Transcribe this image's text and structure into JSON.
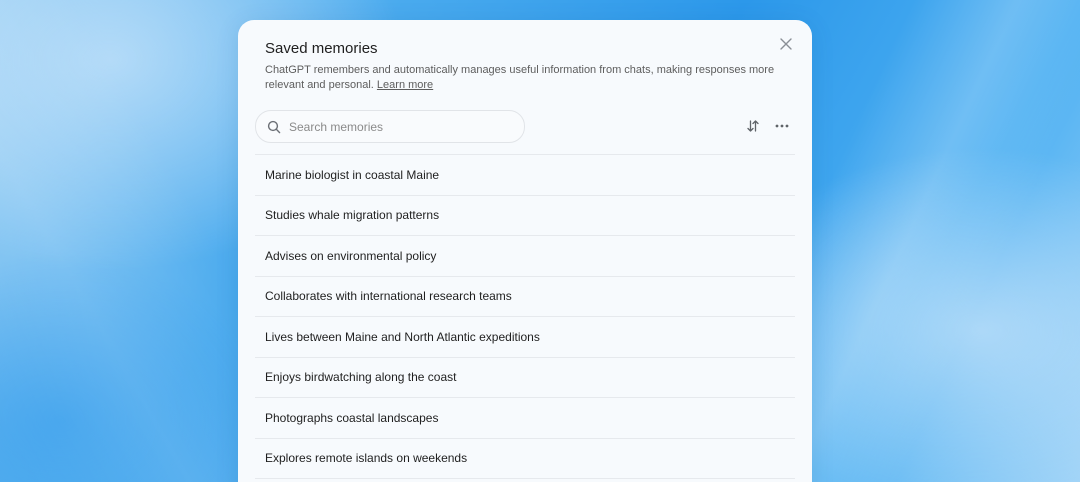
{
  "modal": {
    "title": "Saved memories",
    "description": "ChatGPT remembers and automatically manages useful information from chats, making responses more relevant and personal.",
    "learn_more_label": "Learn more"
  },
  "search": {
    "placeholder": "Search memories",
    "value": ""
  },
  "toolbar": {
    "sort_icon": "sort-arrows-icon",
    "more_icon": "more-horizontal-icon",
    "close_icon": "close-icon"
  },
  "memories": [
    "Marine biologist in coastal Maine",
    "Studies whale migration patterns",
    "Advises on environmental policy",
    "Collaborates with international research teams",
    "Lives between Maine and North Atlantic expeditions",
    "Enjoys birdwatching along the coast",
    "Photographs coastal landscapes",
    "Explores remote islands on weekends"
  ],
  "colors": {
    "background_blue": "#2c98ea",
    "modal_background": "#f7fafd",
    "text_primary": "#1f1f1f",
    "text_secondary": "#5d5d5d",
    "divider": "#e6e9ed"
  }
}
